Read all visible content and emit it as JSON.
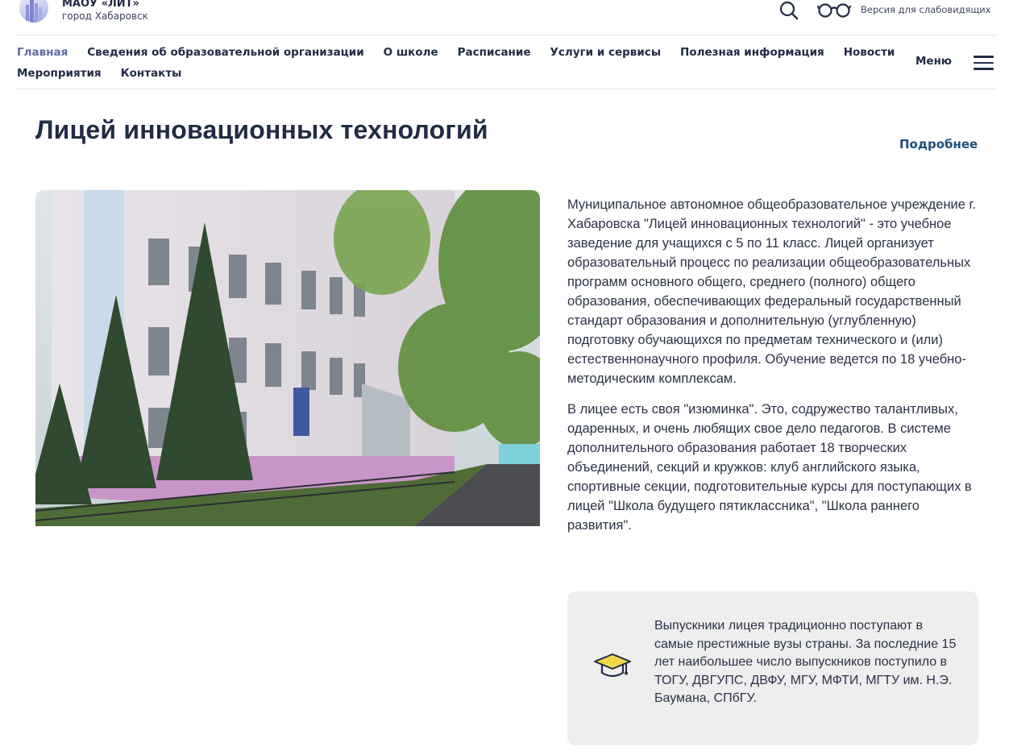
{
  "header": {
    "org_name": "МАОУ «ЛИТ»",
    "org_city": "город Хабаровск",
    "search_icon": "search-icon",
    "low_vision_icon": "glasses-icon",
    "low_vision_label": "Версия для слабовидящих"
  },
  "nav": {
    "row1": [
      "Главная",
      "Сведения об образовательной организации",
      "О школе",
      "Расписание",
      "Услуги и сервисы",
      "Полезная информация",
      "Новости"
    ],
    "row2": [
      "Мероприятия",
      "Контакты"
    ],
    "active": "Главная",
    "menu_label": "Меню",
    "menu_icon": "hamburger-icon"
  },
  "main": {
    "title": "Лицей инновационных технологий",
    "more_link": "Подробнее",
    "photo_alt": "Здание лицея",
    "paragraphs": [
      "Муниципальное автономное общеобразовательное учреждение г. Хабаровска \"Лицей инновационных технологий\" - это учебное заведение для учащихся с 5 по 11 класс. Лицей организует образовательный процесс по реализации общеобразовательных программ основного общего, среднего (полного) общего образования, обеспечивающих федеральный государственный стандарт образования и дополнительную (углубленную) подготовку обучающихся по предметам технического и (или) естественнонаучного профиля. Обучение ведется по 18 учебно-методическим комплексам.",
      "В лицее есть своя \"изюминка\". Это, содружество талантливых, одаренных, и очень любящих свое дело педагогов. В системе дополнительного образования работает 18 творческих объединений, секций и  кружков: клуб английского языка, спортивные секции, подготовительные курсы для поступающих в лицей \"Школа будущего пятиклассника\", \"Школа раннего развития\"."
    ],
    "card": {
      "icon": "graduation-cap-icon",
      "text": "Выпускники лицея  традиционно поступают в самые престижные вузы страны. За последние 15 лет наибольшее число выпускников поступило в ТОГУ, ДВГУПС, ДВФУ, МГУ, МФТИ, МГТУ им. Н.Э. Баумана, СПбГУ."
    }
  },
  "colors": {
    "text_dark": "#222b45",
    "nav_active": "#5e6aa6",
    "link": "#1f4f7d",
    "card_bg": "#eeeeef",
    "cap_accent": "#f2d64b"
  }
}
